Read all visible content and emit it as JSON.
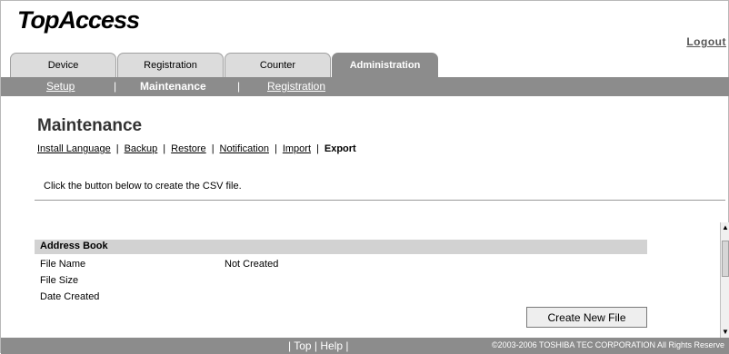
{
  "app": {
    "logo": "TopAccess",
    "logout": "Logout"
  },
  "tabs": [
    {
      "label": "Device",
      "active": false
    },
    {
      "label": "Registration",
      "active": false
    },
    {
      "label": "Counter",
      "active": false
    },
    {
      "label": "Administration",
      "active": true
    }
  ],
  "subnav": {
    "items": [
      "Setup",
      "Maintenance",
      "Registration"
    ],
    "current": "Maintenance"
  },
  "page": {
    "title": "Maintenance",
    "links": [
      "Install Language",
      "Backup",
      "Restore",
      "Notification",
      "Import",
      "Export"
    ],
    "current_link": "Export",
    "instruction": "Click the button below to create the CSV file."
  },
  "address_book": {
    "header": "Address Book",
    "file_name_label": "File Name",
    "file_name_value": "Not Created",
    "file_size_label": "File Size",
    "date_created_label": "Date Created",
    "button": "Create New File"
  },
  "footer": {
    "top": "Top",
    "help": "Help",
    "copyright": "©2003-2006 TOSHIBA TEC CORPORATION All Rights Reserve"
  }
}
